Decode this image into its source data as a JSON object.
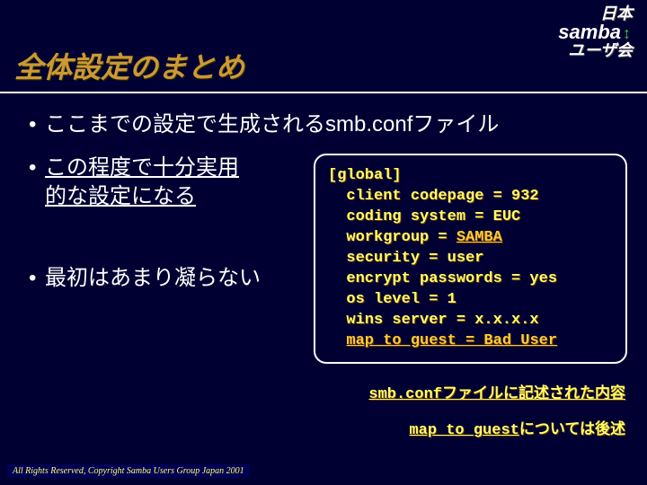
{
  "logo": {
    "jp_top": "日本",
    "word": "samba",
    "jp_bottom": "ユーザ会"
  },
  "title": "全体設定のまとめ",
  "bullets": {
    "b1": "ここまでの設定で生成されるsmb.confファイル",
    "b2a": "この程度で十分実用",
    "b2b": "的な設定になる",
    "b3": "最初はあまり凝らない"
  },
  "code": {
    "l0": "[global]",
    "l1": "  client codepage = 932",
    "l2": "  coding system = EUC",
    "l3_pre": "  workgroup = ",
    "l3_emph": "SAMBA",
    "l4": "  security = user",
    "l5": "  encrypt passwords = yes",
    "l6": "  os level = 1",
    "l7": "  wins server = x.x.x.x",
    "l8_pre": "  ",
    "l8_emph": "map to guest = Bad User"
  },
  "caption1": "smb.confファイルに記述された内容",
  "caption2": {
    "u": "map to guest",
    "rest": "については後述"
  },
  "footer": "All Rights Reserved, Copyright Samba Users Group Japan 2001"
}
